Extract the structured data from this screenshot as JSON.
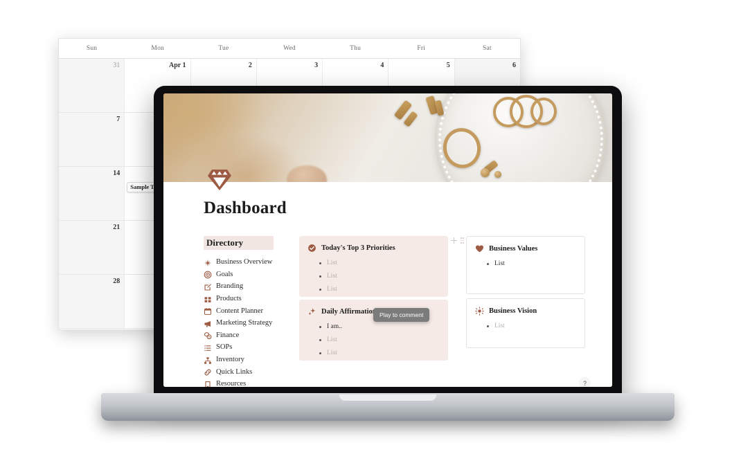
{
  "calendar": {
    "day_headers": [
      "Sun",
      "Mon",
      "Tue",
      "Wed",
      "Thu",
      "Fri",
      "Sat"
    ],
    "weeks": [
      {
        "days": [
          {
            "label": "31",
            "muted": true,
            "weekend": true
          },
          {
            "label": "Apr 1",
            "muted": false,
            "weekend": false
          },
          {
            "label": "2",
            "muted": false,
            "weekend": false
          },
          {
            "label": "3",
            "muted": false,
            "weekend": false
          },
          {
            "label": "4",
            "muted": false,
            "weekend": false
          },
          {
            "label": "5",
            "muted": false,
            "weekend": false
          },
          {
            "label": "6",
            "muted": false,
            "weekend": true
          }
        ]
      },
      {
        "days": [
          {
            "label": "7",
            "muted": false,
            "weekend": true
          },
          {
            "label": "",
            "muted": false,
            "weekend": false
          },
          {
            "label": "",
            "muted": false,
            "weekend": false
          },
          {
            "label": "",
            "muted": false,
            "weekend": false
          },
          {
            "label": "",
            "muted": false,
            "weekend": false
          },
          {
            "label": "",
            "muted": false,
            "weekend": false
          },
          {
            "label": "",
            "muted": false,
            "weekend": true
          }
        ]
      },
      {
        "days": [
          {
            "label": "14",
            "muted": false,
            "weekend": true
          },
          {
            "label": "",
            "muted": false,
            "weekend": false,
            "event": "Sample T"
          },
          {
            "label": "",
            "muted": false,
            "weekend": false
          },
          {
            "label": "",
            "muted": false,
            "weekend": false
          },
          {
            "label": "",
            "muted": false,
            "weekend": false
          },
          {
            "label": "",
            "muted": false,
            "weekend": false
          },
          {
            "label": "",
            "muted": false,
            "weekend": true
          }
        ]
      },
      {
        "days": [
          {
            "label": "21",
            "muted": false,
            "weekend": true
          },
          {
            "label": "",
            "muted": false,
            "weekend": false
          },
          {
            "label": "",
            "muted": false,
            "weekend": false
          },
          {
            "label": "",
            "muted": false,
            "weekend": false
          },
          {
            "label": "",
            "muted": false,
            "weekend": false
          },
          {
            "label": "",
            "muted": false,
            "weekend": false
          },
          {
            "label": "",
            "muted": false,
            "weekend": true
          }
        ]
      },
      {
        "days": [
          {
            "label": "28",
            "muted": false,
            "weekend": true
          },
          {
            "label": "",
            "muted": false,
            "weekend": false
          },
          {
            "label": "",
            "muted": false,
            "weekend": false
          },
          {
            "label": "",
            "muted": false,
            "weekend": false
          },
          {
            "label": "",
            "muted": false,
            "weekend": false
          },
          {
            "label": "",
            "muted": false,
            "weekend": false
          },
          {
            "label": "",
            "muted": false,
            "weekend": true
          }
        ]
      }
    ]
  },
  "hero": {
    "image_alt": "gold rings and earrings on a white ceramic dish"
  },
  "brand": {
    "logo_icon": "diamond-gem-icon",
    "logo_color": "#9C5B42"
  },
  "page": {
    "title": "Dashboard",
    "help_label": "?",
    "tooltip": "Play to comment"
  },
  "directory": {
    "heading": "Directory",
    "items": [
      {
        "label": "Business Overview",
        "icon": "sparkle-icon"
      },
      {
        "label": "Goals",
        "icon": "target-icon"
      },
      {
        "label": "Branding",
        "icon": "pencil-square-icon"
      },
      {
        "label": "Products",
        "icon": "grid-icon"
      },
      {
        "label": "Content Planner",
        "icon": "calendar-icon"
      },
      {
        "label": "Marketing Strategy",
        "icon": "megaphone-icon"
      },
      {
        "label": "Finance",
        "icon": "coins-icon"
      },
      {
        "label": "SOPs",
        "icon": "list-icon"
      },
      {
        "label": "Inventory",
        "icon": "org-chart-icon"
      },
      {
        "label": "Quick Links",
        "icon": "link-icon"
      },
      {
        "label": "Resources",
        "icon": "bookmark-icon"
      }
    ]
  },
  "cards": [
    {
      "title": "Today's Top 3 Priorities",
      "icon": "check-circle-icon",
      "style": "pink",
      "bullets": [
        {
          "text": "List",
          "filled": false
        },
        {
          "text": "List",
          "filled": false
        },
        {
          "text": "List",
          "filled": false
        }
      ]
    },
    {
      "title": "Daily Affirmations",
      "icon": "sparkles-icon",
      "style": "pink",
      "bullets": [
        {
          "text": "I am..",
          "filled": true
        },
        {
          "text": "List",
          "filled": false
        },
        {
          "text": "List",
          "filled": false
        }
      ]
    },
    {
      "title": "Business Values",
      "icon": "heart-icon",
      "style": "plain",
      "bullets": [
        {
          "text": "List",
          "filled": true
        }
      ]
    },
    {
      "title": "Business Vision",
      "icon": "sun-icon",
      "style": "plain",
      "bullets": [
        {
          "text": "List",
          "filled": false
        }
      ]
    }
  ],
  "block_controls": {
    "add_icon": "plus-icon",
    "drag_icon": "drag-handle-icon"
  },
  "colors": {
    "accent_brown": "#9C5B42",
    "card_pink": "#f6eae6",
    "highlight": "#f2e6e2"
  }
}
